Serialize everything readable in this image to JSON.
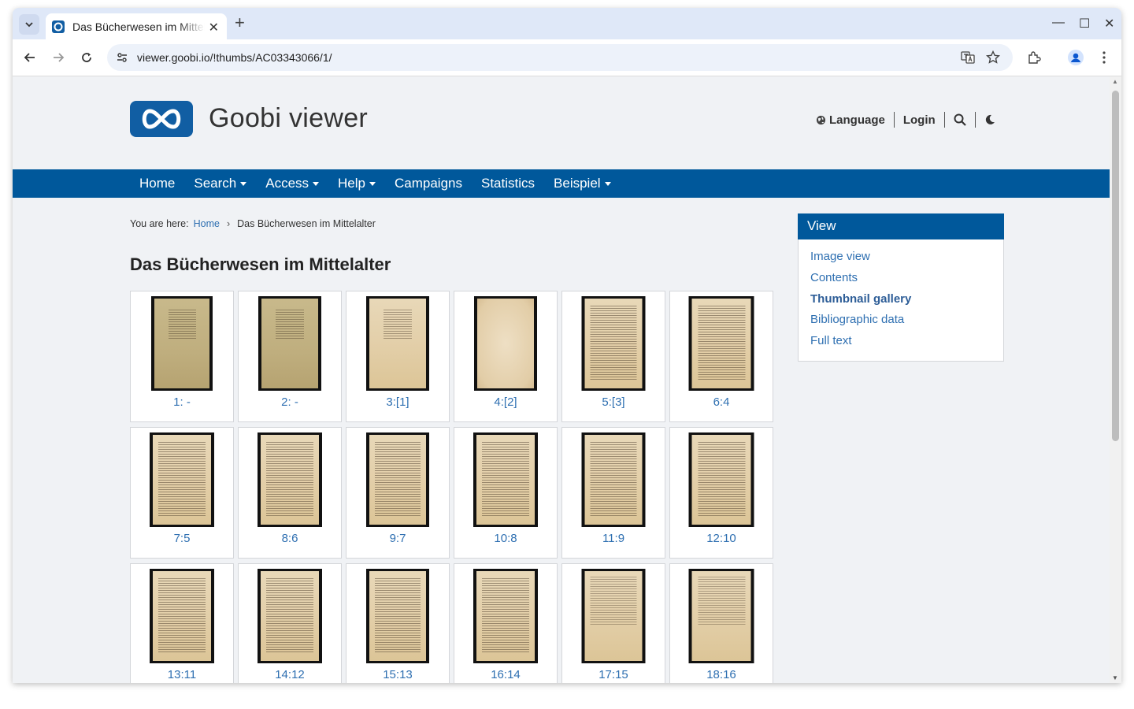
{
  "browser": {
    "tab_title": "Das Bücherwesen im Mittelalter",
    "url": "viewer.goobi.io/!thumbs/AC03343066/1/"
  },
  "site": {
    "title": "Goobi viewer",
    "header_links": {
      "language": "Language",
      "login": "Login"
    }
  },
  "mainnav": {
    "items": [
      {
        "label": "Home",
        "dropdown": false
      },
      {
        "label": "Search",
        "dropdown": true
      },
      {
        "label": "Access",
        "dropdown": true
      },
      {
        "label": "Help",
        "dropdown": true
      },
      {
        "label": "Campaigns",
        "dropdown": false
      },
      {
        "label": "Statistics",
        "dropdown": false
      },
      {
        "label": "Beispiel",
        "dropdown": true
      }
    ]
  },
  "breadcrumb": {
    "prefix": "You are here:",
    "home": "Home",
    "current": "Das Bücherwesen im Mittelalter"
  },
  "page": {
    "title": "Das Bücherwesen im Mittelalter"
  },
  "thumbnails": [
    {
      "label": "1: -",
      "kind": "cover"
    },
    {
      "label": "2: -",
      "kind": "cover"
    },
    {
      "label": "3:[1]",
      "kind": "title"
    },
    {
      "label": "4:[2]",
      "kind": "blank"
    },
    {
      "label": "5:[3]",
      "kind": "text"
    },
    {
      "label": "6:4",
      "kind": "text"
    },
    {
      "label": "7:5",
      "kind": "text"
    },
    {
      "label": "8:6",
      "kind": "text"
    },
    {
      "label": "9:7",
      "kind": "text"
    },
    {
      "label": "10:8",
      "kind": "text"
    },
    {
      "label": "11:9",
      "kind": "text"
    },
    {
      "label": "12:10",
      "kind": "text"
    },
    {
      "label": "13:11",
      "kind": "text"
    },
    {
      "label": "14:12",
      "kind": "text"
    },
    {
      "label": "15:13",
      "kind": "text"
    },
    {
      "label": "16:14",
      "kind": "text"
    },
    {
      "label": "17:15",
      "kind": "sparse"
    },
    {
      "label": "18:16",
      "kind": "sparse"
    }
  ],
  "sidebar": {
    "title": "View",
    "items": [
      {
        "label": "Image view",
        "active": false
      },
      {
        "label": "Contents",
        "active": false
      },
      {
        "label": "Thumbnail gallery",
        "active": true
      },
      {
        "label": "Bibliographic data",
        "active": false
      },
      {
        "label": "Full text",
        "active": false
      }
    ]
  },
  "colors": {
    "brand_blue": "#00589b",
    "link_blue": "#2e6fb1",
    "logo_blue": "#115ea3"
  }
}
